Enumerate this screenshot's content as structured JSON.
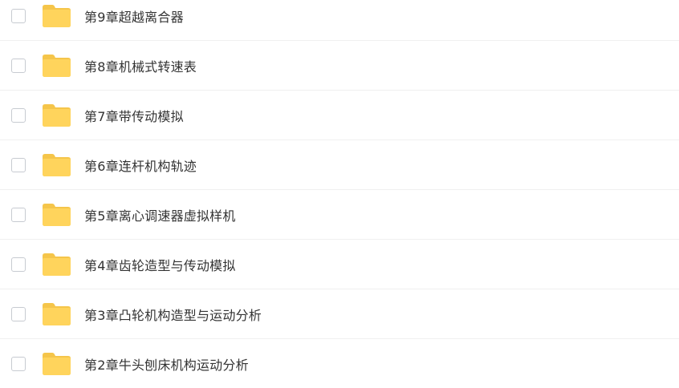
{
  "colors": {
    "folder_back": "#F5C54A",
    "folder_front": "#FFD45C",
    "text": "#333333",
    "divider": "#F0F0F0",
    "checkbox_border": "#C7CBD1"
  },
  "files": [
    {
      "name": "第9章超越离合器",
      "icon": "folder-icon"
    },
    {
      "name": "第8章机械式转速表",
      "icon": "folder-icon"
    },
    {
      "name": "第7章带传动模拟",
      "icon": "folder-icon"
    },
    {
      "name": "第6章连杆机构轨迹",
      "icon": "folder-icon"
    },
    {
      "name": "第5章离心调速器虚拟样机",
      "icon": "folder-icon"
    },
    {
      "name": "第4章齿轮造型与传动模拟",
      "icon": "folder-icon"
    },
    {
      "name": "第3章凸轮机构造型与运动分析",
      "icon": "folder-icon"
    },
    {
      "name": "第2章牛头刨床机构运动分析",
      "icon": "folder-icon"
    }
  ]
}
